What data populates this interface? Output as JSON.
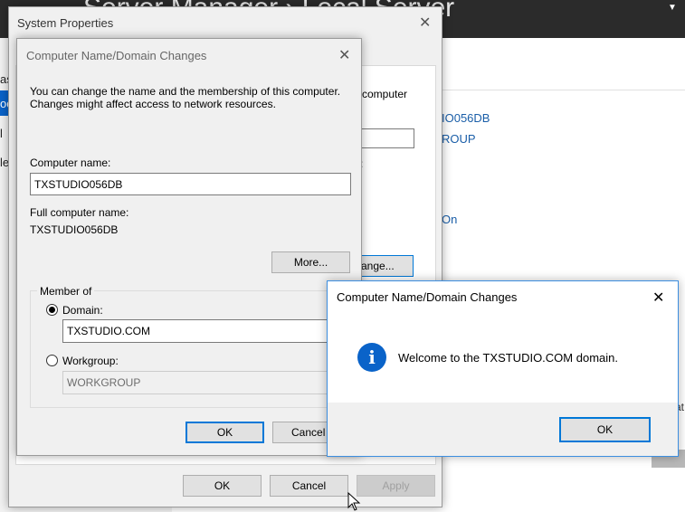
{
  "background": {
    "title": "Server Manager › Local Server",
    "left_chars": [
      "as",
      "oc",
      "l",
      "le"
    ],
    "right_values": [
      "IO056DB",
      "ROUP",
      "On"
    ],
    "partial_computer_text": "computer",
    "right_edge_text": "at"
  },
  "system_properties": {
    "title": "System Properties",
    "change_button": "ange...",
    "ok": "OK",
    "cancel": "Cancel",
    "apply": "Apply"
  },
  "domain_changes": {
    "title": "Computer Name/Domain Changes",
    "description": "You can change the name and the membership of this computer. Changes might affect access to network resources.",
    "computer_name_label": "Computer name:",
    "computer_name_value": "TXSTUDIO056DB",
    "full_name_label": "Full computer name:",
    "full_name_value": "TXSTUDIO056DB",
    "more_button": "More...",
    "member_of_label": "Member of",
    "domain_label": "Domain:",
    "domain_value": "TXSTUDIO.COM",
    "workgroup_label": "Workgroup:",
    "workgroup_value": "WORKGROUP",
    "ok": "OK",
    "cancel": "Cancel"
  },
  "welcome_dialog": {
    "title": "Computer Name/Domain Changes",
    "message": "Welcome to the TXSTUDIO.COM domain.",
    "ok": "OK",
    "icon": "info-icon"
  },
  "colors": {
    "accent": "#0078d7",
    "info": "#0a63c9",
    "titlebar": "#2b2b2b"
  }
}
